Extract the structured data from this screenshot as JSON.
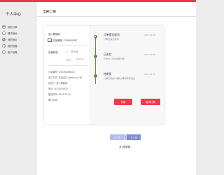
{
  "sidebar": {
    "title": "个人中心",
    "items": [
      {
        "icon": "house-icon",
        "label": "我的订单"
      },
      {
        "icon": "document-icon",
        "label": "退货地址"
      },
      {
        "icon": "location-icon",
        "label": "我的地址"
      },
      {
        "icon": "star-icon",
        "label": "我的收藏"
      },
      {
        "icon": "gear-icon",
        "label": "账户设置"
      }
    ]
  },
  "main": {
    "title": "全部订单"
  },
  "order": {
    "shop_name": "洛人腾旗网",
    "store": "店铺客服: 17900001387",
    "product_name": "店铺商品",
    "quantity": "1",
    "price": "¥ 0.01",
    "paid_label": "实付:",
    "paid_value": "¥ 0.01",
    "info": [
      "订单编号: 1031954896233",
      "支付方式: 在线支付 (weixin_ne 号)",
      "收货人: 洛人腾旗网",
      "电话: 18710001929",
      "配送时间: 18:00-20:00",
      "备注信息:"
    ]
  },
  "tracking": [
    {
      "title": "订单提交成功",
      "subtitle": "订单已提交成功",
      "date": "2017-11-29"
    },
    {
      "title": "已支付",
      "subtitle": "已支付, 正在处理订单",
      "date": "2017-11-29"
    },
    {
      "title": "待发货",
      "subtitle": "订单已完成, 请耐心等待商家发货",
      "date": "2017-11-29"
    }
  ],
  "buttons": {
    "pay": "付款",
    "cancel": "取消订单"
  },
  "pagination": {
    "prev": "上一页",
    "page": "1",
    "next": "下一页"
  },
  "footer": "共1条数据",
  "colors": {
    "accent": "#e83a4a",
    "timeline": "#6b8d36",
    "pager": "#7e8dd7"
  }
}
